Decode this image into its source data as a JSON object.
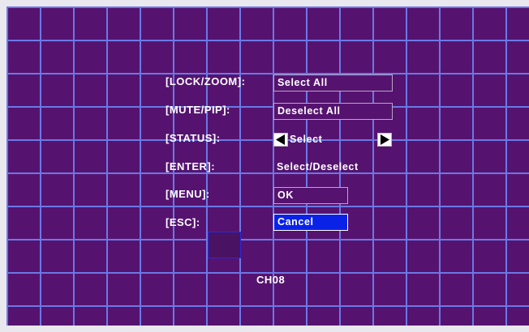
{
  "menu": {
    "rows": [
      {
        "key": "[LOCK/ZOOM]:",
        "value": "Select All"
      },
      {
        "key": "[MUTE/PIP]:",
        "value": "Deselect All"
      },
      {
        "key": "[STATUS]:",
        "value": "Select"
      },
      {
        "key": "[ENTER]:",
        "value": "Select/Deselect"
      },
      {
        "key": "[MENU]:",
        "value": "OK"
      },
      {
        "key": "[ESC]:",
        "value": "Cancel"
      }
    ]
  },
  "channel": "CH08",
  "colors": {
    "background": "#55136f",
    "grid": "#6b78e6",
    "selected": "#0a22e8",
    "text": "#ffffff"
  },
  "icons": {
    "left_arrow": "left-arrow-icon",
    "right_arrow": "right-arrow-icon"
  }
}
